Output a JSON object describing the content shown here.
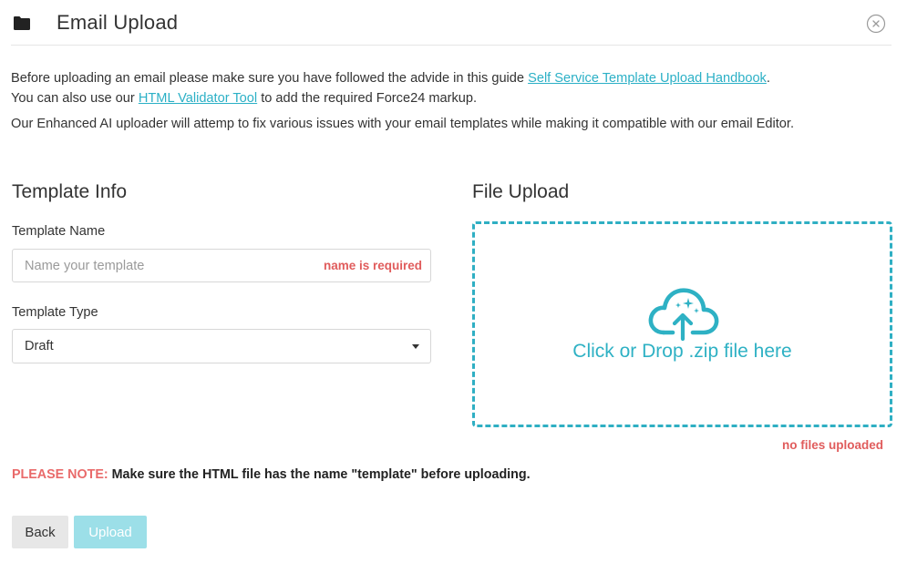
{
  "header": {
    "title": "Email Upload",
    "folder_icon": "folder-icon",
    "close_icon": "close-circle-icon"
  },
  "intro": {
    "p1_a": "Before uploading an email please make sure you have followed the advide in this guide ",
    "p1_link": "Self Service Template Upload Handbook",
    "p1_b": ".",
    "p2_a": "You can also use our ",
    "p2_link": "HTML Validator Tool",
    "p2_b": " to add the required Force24 markup.",
    "p3": "Our Enhanced AI uploader will attemp to fix various issues with your email templates while making it compatible with our email Editor."
  },
  "template_info": {
    "heading": "Template Info",
    "name_label": "Template Name",
    "name_placeholder": "Name your template",
    "name_value": "",
    "name_error": "name is required",
    "type_label": "Template Type",
    "type_value": "Draft"
  },
  "file_upload": {
    "heading": "File Upload",
    "drop_text": "Click or Drop .zip file here",
    "upload_icon": "cloud-upload-sparkle-icon",
    "status": "no files uploaded"
  },
  "note": {
    "prefix": "PLEASE NOTE:",
    "text": " Make sure the HTML file has the name \"template\" before uploading."
  },
  "actions": {
    "back_label": "Back",
    "upload_label": "Upload"
  },
  "colors": {
    "accent": "#2eb1c4",
    "error": "#e05c5c",
    "upload_button_disabled": "#9cdfe8",
    "back_button": "#e7e7e7"
  }
}
